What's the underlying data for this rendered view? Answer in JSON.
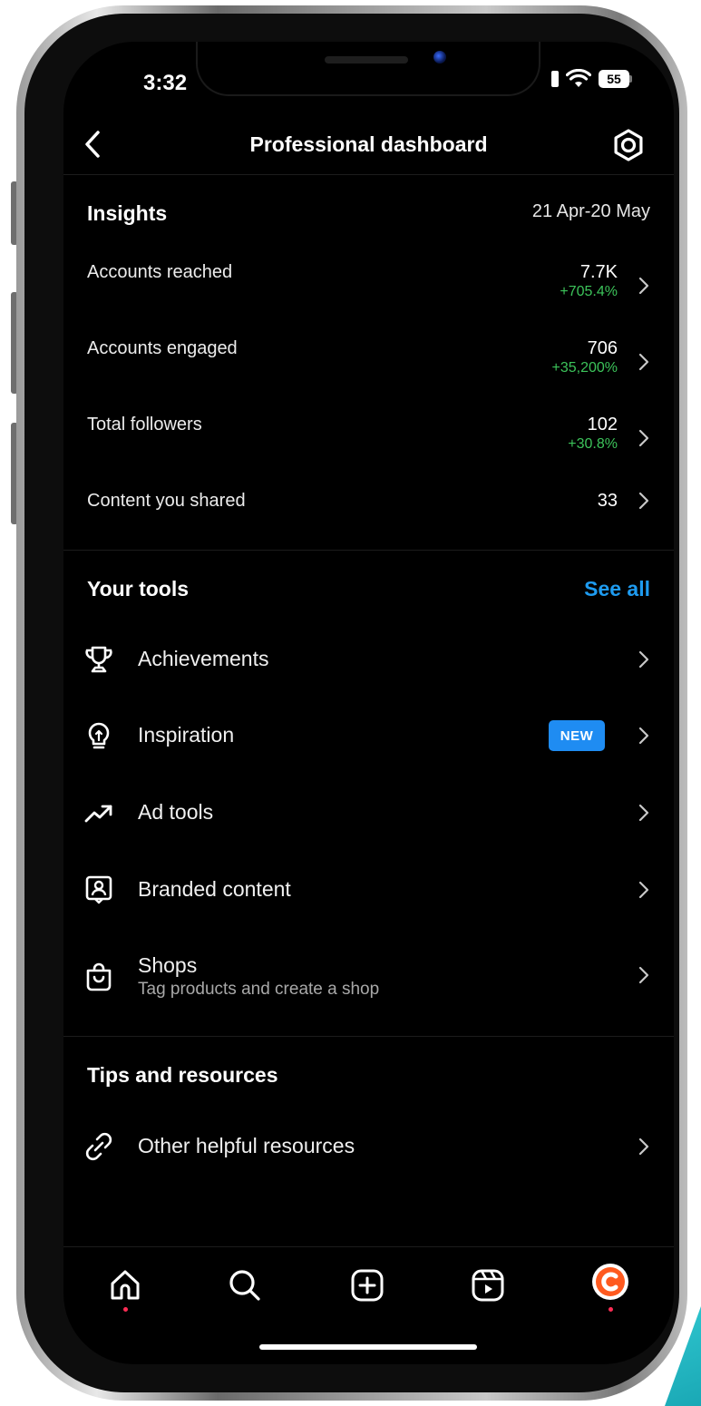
{
  "status_bar": {
    "time": "3:32",
    "battery": "55"
  },
  "header": {
    "title": "Professional dashboard"
  },
  "insights": {
    "heading": "Insights",
    "date_range": "21 Apr-20 May",
    "metrics": [
      {
        "label": "Accounts reached",
        "value": "7.7K",
        "change": "+705.4%"
      },
      {
        "label": "Accounts engaged",
        "value": "706",
        "change": "+35,200%"
      },
      {
        "label": "Total followers",
        "value": "102",
        "change": "+30.8%"
      },
      {
        "label": "Content you shared",
        "value": "33",
        "change": ""
      }
    ]
  },
  "tools": {
    "heading": "Your tools",
    "see_all": "See all",
    "items": [
      {
        "label": "Achievements",
        "icon": "trophy-icon"
      },
      {
        "label": "Inspiration",
        "icon": "lightbulb-icon",
        "badge": "NEW"
      },
      {
        "label": "Ad tools",
        "icon": "trending-up-icon"
      },
      {
        "label": "Branded content",
        "icon": "branded-content-icon"
      },
      {
        "label": "Shops",
        "sublabel": "Tag products and create a shop",
        "icon": "shopping-bag-icon"
      }
    ]
  },
  "tips": {
    "heading": "Tips and resources",
    "items": [
      {
        "label": "Other helpful resources",
        "icon": "link-icon"
      }
    ]
  },
  "tab_bar": {
    "tabs": [
      "home-icon",
      "search-icon",
      "create-icon",
      "reels-icon",
      "profile-avatar"
    ],
    "colors": {
      "notification_dot": "#ff2d55",
      "accent_blue": "#1e9bf0",
      "positive_green": "#3cc35a"
    }
  }
}
